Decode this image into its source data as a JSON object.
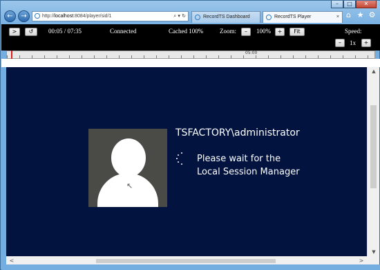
{
  "window": {
    "controls": {
      "minimize": "–",
      "maximize": "□",
      "close": "✕"
    }
  },
  "browser": {
    "back_icon": "←",
    "forward_icon": "→",
    "address": {
      "url_prefix": "http://",
      "url_host": "localhost",
      "url_rest": ":8084/player/sid/1",
      "actions": "⌕ ▾ ↻"
    },
    "tabs": [
      {
        "label": "RecordTS Dashboard",
        "close": "",
        "active": false
      },
      {
        "label": "RecordTS Player",
        "close": "×",
        "active": true
      }
    ],
    "tools": {
      "home": "⌂",
      "favorites": "★",
      "settings": "⚙"
    }
  },
  "player": {
    "play_button": ">",
    "reload_button": "↺",
    "time": "00:05 / 07:35",
    "status": "Connected",
    "cache": "Cached 100%",
    "zoom_label": "Zoom:",
    "zoom_minus": "–",
    "zoom_value": "100%",
    "zoom_plus": "+",
    "fit_button": "Fit",
    "speed_label": "Speed:",
    "speed_minus": "–",
    "speed_value": "1x",
    "speed_plus": "+",
    "timeline": {
      "marker_label": "05:00",
      "position_fraction": 0.011
    }
  },
  "session": {
    "username": "TSFACTORY\\administrator",
    "message_line1": "Please wait for the",
    "message_line2": "Local Session Manager",
    "background_color": "#021340",
    "cursor_icon": "↖"
  },
  "scrollbars": {
    "up": "▲",
    "down": "▼",
    "left": "<",
    "right": ">"
  }
}
